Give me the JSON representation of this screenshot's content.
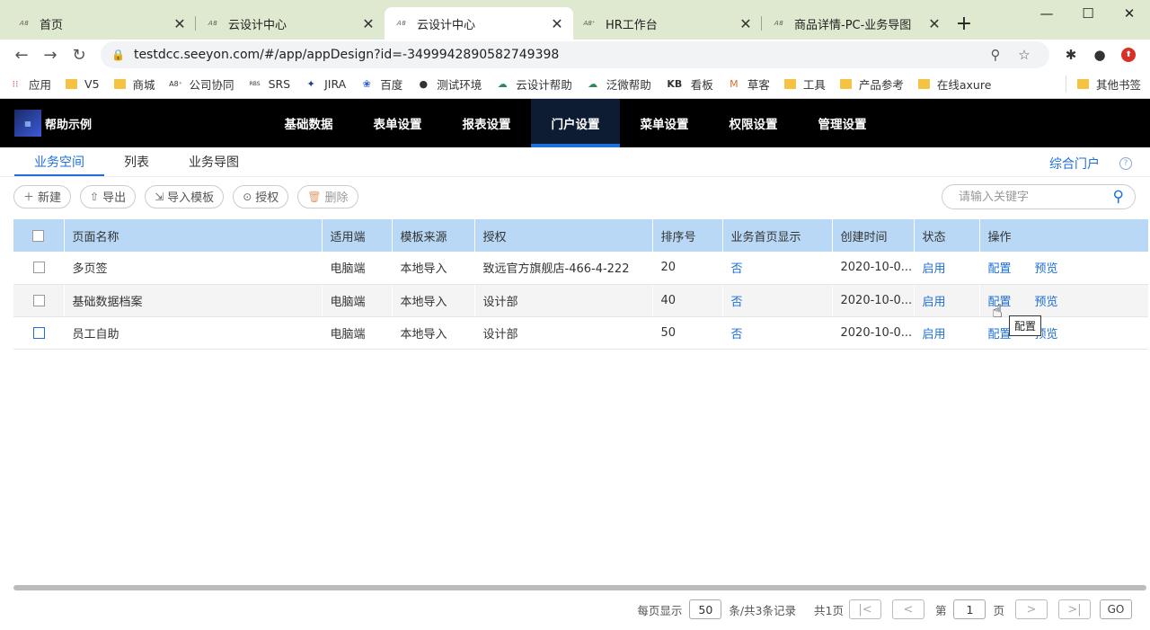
{
  "browser": {
    "tabs": [
      {
        "title": "首页",
        "active": false
      },
      {
        "title": "云设计中心",
        "active": false
      },
      {
        "title": "云设计中心",
        "active": true
      },
      {
        "title": "HR工作台",
        "active": false
      },
      {
        "title": "商品详情-PC-业务导图",
        "active": false
      }
    ],
    "url": "testdcc.seeyon.com/#/app/appDesign?id=-3499942890582749398",
    "bookmarks": [
      "应用",
      "V5",
      "商城",
      "公司协同",
      "SRS",
      "JIRA",
      "百度",
      "测试环境",
      "云设计帮助",
      "泛微帮助",
      "看板",
      "草客",
      "工具",
      "产品参考",
      "在线axure"
    ],
    "bookmarks_other": "其他书签",
    "kb_label": "KB"
  },
  "app": {
    "name": "帮助示例",
    "nav": [
      "基础数据",
      "表单设置",
      "报表设置",
      "门户设置",
      "菜单设置",
      "权限设置",
      "管理设置"
    ],
    "nav_active": "门户设置",
    "subtabs": [
      "业务空间",
      "列表",
      "业务导图"
    ],
    "subtab_active": "业务空间",
    "portal_link": "综合门户",
    "actions": {
      "new": "新建",
      "export": "导出",
      "import_template": "导入模板",
      "authorize": "授权",
      "delete": "删除"
    },
    "search_placeholder": "请输入关键字"
  },
  "table": {
    "headers": [
      "页面名称",
      "适用端",
      "模板来源",
      "授权",
      "排序号",
      "业务首页显示",
      "创建时间",
      "状态",
      "操作"
    ],
    "rows": [
      {
        "name": "多页签",
        "platform": "电脑端",
        "source": "本地导入",
        "auth": "致远官方旗舰店-466-4-222",
        "order": "20",
        "home": "否",
        "created": "2020-10-0...",
        "status": "启用",
        "op1": "配置",
        "op2": "预览"
      },
      {
        "name": "基础数据档案",
        "platform": "电脑端",
        "source": "本地导入",
        "auth": "设计部",
        "order": "40",
        "home": "否",
        "created": "2020-10-0...",
        "status": "启用",
        "op1": "配置",
        "op2": "预览"
      },
      {
        "name": "员工自助",
        "platform": "电脑端",
        "source": "本地导入",
        "auth": "设计部",
        "order": "50",
        "home": "否",
        "created": "2020-10-0...",
        "status": "启用",
        "op1": "配置",
        "op2": "预览"
      }
    ],
    "tooltip": "配置"
  },
  "pager": {
    "per_page_label": "每页显示",
    "per_page": "50",
    "total_label": "条/共3条记录",
    "pages_label": "共1页",
    "page_prefix": "第",
    "page": "1",
    "page_suffix": "页",
    "go": "GO"
  },
  "colors": {
    "accent": "#1e6fd9",
    "header_bg": "#000000",
    "table_header": "#b8d8f5",
    "tabstrip": "#dfe9cf"
  }
}
